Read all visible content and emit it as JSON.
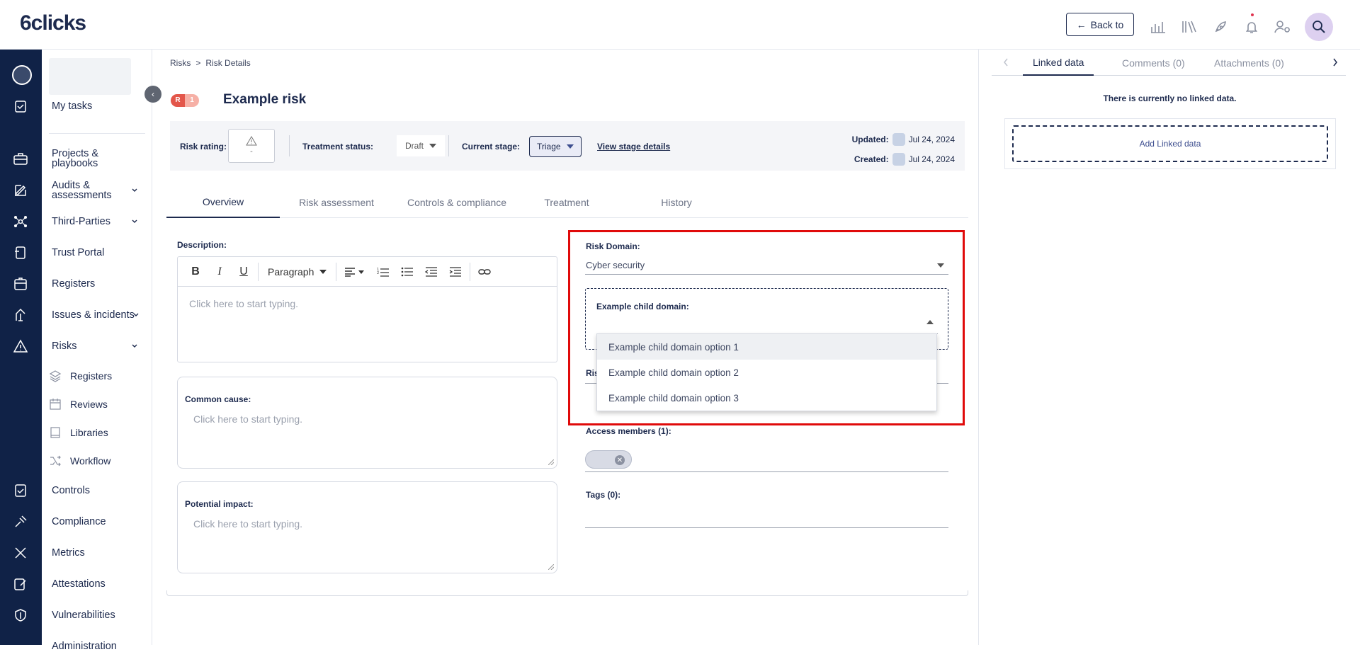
{
  "app": {
    "logo": "6clicks",
    "back_label": "Back to"
  },
  "sidebar": {
    "my_tasks": "My tasks",
    "items": [
      {
        "label": "Projects &\nplaybooks"
      },
      {
        "label": "Audits &\nassessments"
      },
      {
        "label": "Third-Parties"
      },
      {
        "label": "Trust Portal"
      },
      {
        "label": "Registers"
      },
      {
        "label": "Issues & incidents"
      },
      {
        "label": "Risks"
      },
      {
        "label": "Controls"
      },
      {
        "label": "Compliance"
      },
      {
        "label": "Metrics"
      },
      {
        "label": "Attestations"
      },
      {
        "label": "Vulnerabilities"
      },
      {
        "label": "Administration"
      }
    ],
    "risk_sub": [
      {
        "label": "Registers",
        "icon": "layers-icon"
      },
      {
        "label": "Reviews",
        "icon": "calendar-icon"
      },
      {
        "label": "Libraries",
        "icon": "book-icon"
      },
      {
        "label": "Workflow",
        "icon": "shuffle-icon"
      }
    ]
  },
  "breadcrumb": {
    "root": "Risks",
    "sep": ">",
    "current": "Risk Details"
  },
  "risk": {
    "badge_letter": "R",
    "badge_count": "1",
    "title": "Example risk",
    "rating_label": "Risk rating:",
    "rating_value": "-",
    "treatment_label": "Treatment status:",
    "treatment_value": "Draft",
    "stage_label": "Current stage:",
    "stage_value": "Triage",
    "stage_link": "View stage details",
    "updated_label": "Updated:",
    "updated_value": "Jul 24, 2024",
    "created_label": "Created:",
    "created_value": "Jul 24, 2024"
  },
  "tabs": [
    "Overview",
    "Risk assessment",
    "Controls & compliance",
    "Treatment",
    "History"
  ],
  "form": {
    "description_label": "Description:",
    "editor_para": "Paragraph",
    "editor_placeholder": "Click here to start typing.",
    "common_cause_label": "Common cause:",
    "common_cause_placeholder": "Click here to start typing.",
    "potential_impact_label": "Potential impact:",
    "potential_impact_placeholder": "Click here to start typing.",
    "risk_domain_label": "Risk Domain:",
    "risk_domain_value": "Cyber security",
    "child_domain_label": "Example child domain:",
    "child_domain_options": [
      "Example child domain option 1",
      "Example child domain option 2",
      "Example child domain option 3"
    ],
    "hidden_label_fragment": "Ris",
    "access_members_label": "Access members (1):",
    "tags_label": "Tags (0):"
  },
  "right_panel": {
    "tabs": [
      "Linked data",
      "Comments (0)",
      "Attachments (0)"
    ],
    "empty_text": "There is currently no linked data.",
    "add_label": "Add Linked data"
  },
  "colors": {
    "navy": "#102247",
    "accent": "#1d2a4e",
    "highlight": "#e00a0a",
    "badge": "#e3564a"
  }
}
